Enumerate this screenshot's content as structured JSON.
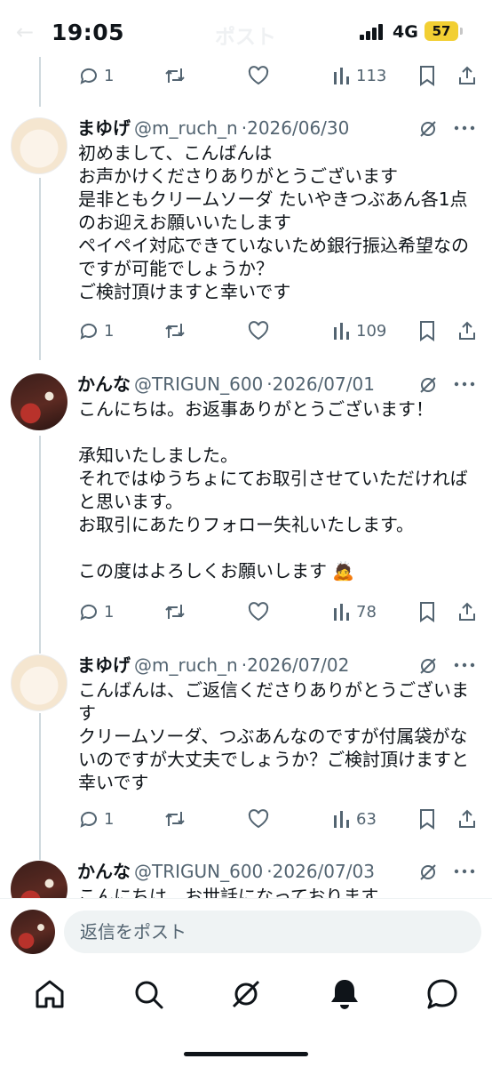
{
  "status_bar": {
    "time": "19:05",
    "network": "4G",
    "battery": "57",
    "back_ghost": "←",
    "title_ghost": "ポスト"
  },
  "top_actions": {
    "replies": "1",
    "views": "113"
  },
  "posts": [
    {
      "name": "まゆげ",
      "handle": "@m_ruch_n",
      "date": "2026/06/30",
      "text": "初めまして、こんばんは\nお声かけくださりありがとうございます\n是非ともクリームソーダ たいやきつぶあん各1点\nのお迎えお願いいたします\nペイペイ対応できていないため銀行振込希望なの\nですが可能でしょうか？\nご検討頂けますと幸いです",
      "replies": "1",
      "views": "109"
    },
    {
      "name": "かんな",
      "handle": "@TRIGUN_600",
      "date": "2026/07/01",
      "text": "こんにちは。お返事ありがとうございます！\n\n承知いたしました。\nそれではゆうちょにてお取引させていただければ\nと思います。\nお取引にあたりフォロー失礼いたします。\n\nこの度はよろしくお願いします",
      "emoji": "🙇",
      "replies": "1",
      "views": "78"
    },
    {
      "name": "まゆげ",
      "handle": "@m_ruch_n",
      "date": "2026/07/02",
      "text": "こんばんは、ご返信くださりありがとうございま\nす\nクリームソーダ、つぶあんなのですが付属袋がな\nいのですが大丈夫でしょうか？ご検討頂けますと\n幸いです",
      "replies": "1",
      "views": "63"
    },
    {
      "name": "かんな",
      "handle": "@TRIGUN_600",
      "date": "2026/07/03",
      "text": "こんにちは。お世話になっております。"
    }
  ],
  "composer": {
    "placeholder": "返信をポスト"
  },
  "icons": {
    "reply": "reply-icon",
    "repost": "repost-icon",
    "like": "like-icon",
    "views": "views-icon",
    "bookmark": "bookmark-icon",
    "share": "share-icon",
    "grok": "grok-icon",
    "more": "more-icon",
    "nav": [
      "home-icon",
      "search-icon",
      "grok-icon",
      "notifications-icon",
      "messages-icon"
    ]
  }
}
